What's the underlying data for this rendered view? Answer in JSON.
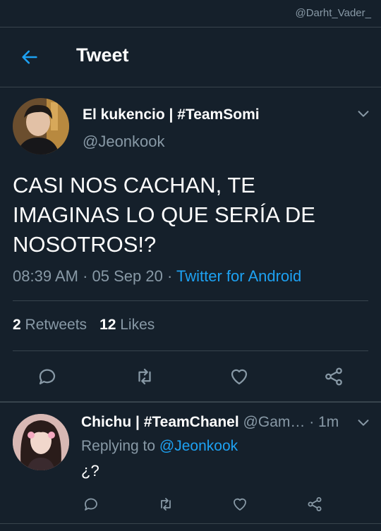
{
  "watermark": "@Darht_Vader_",
  "header": {
    "title": "Tweet"
  },
  "tweet": {
    "display_name": "El kukencio | #TeamSomi",
    "handle": "@Jeonkook",
    "text": "CASI NOS CACHAN, TE IMAGINAS LO QUE SERÍA DE NOSOTROS!?",
    "time": "08:39 AM",
    "date": "05 Sep 20",
    "separator": " · ",
    "source": "Twitter for Android",
    "retweets_count": "2",
    "retweets_label": " Retweets",
    "likes_count": "12",
    "likes_label": " Likes"
  },
  "reply": {
    "display_name": "Chichu | #TeamChanel",
    "handle": " @Gam…",
    "time": " · 1m",
    "replying_prefix": "Replying to ",
    "replying_to": "@Jeonkook",
    "text": "¿?"
  },
  "colors": {
    "background": "#15202b",
    "accent": "#1da1f2",
    "secondary_text": "#8899a6",
    "divider": "#38444d"
  },
  "icons": {
    "back": "arrow-left-icon",
    "more": "chevron-down-icon",
    "reply": "comment-icon",
    "retweet": "retweet-icon",
    "like": "heart-icon",
    "share": "share-icon"
  }
}
